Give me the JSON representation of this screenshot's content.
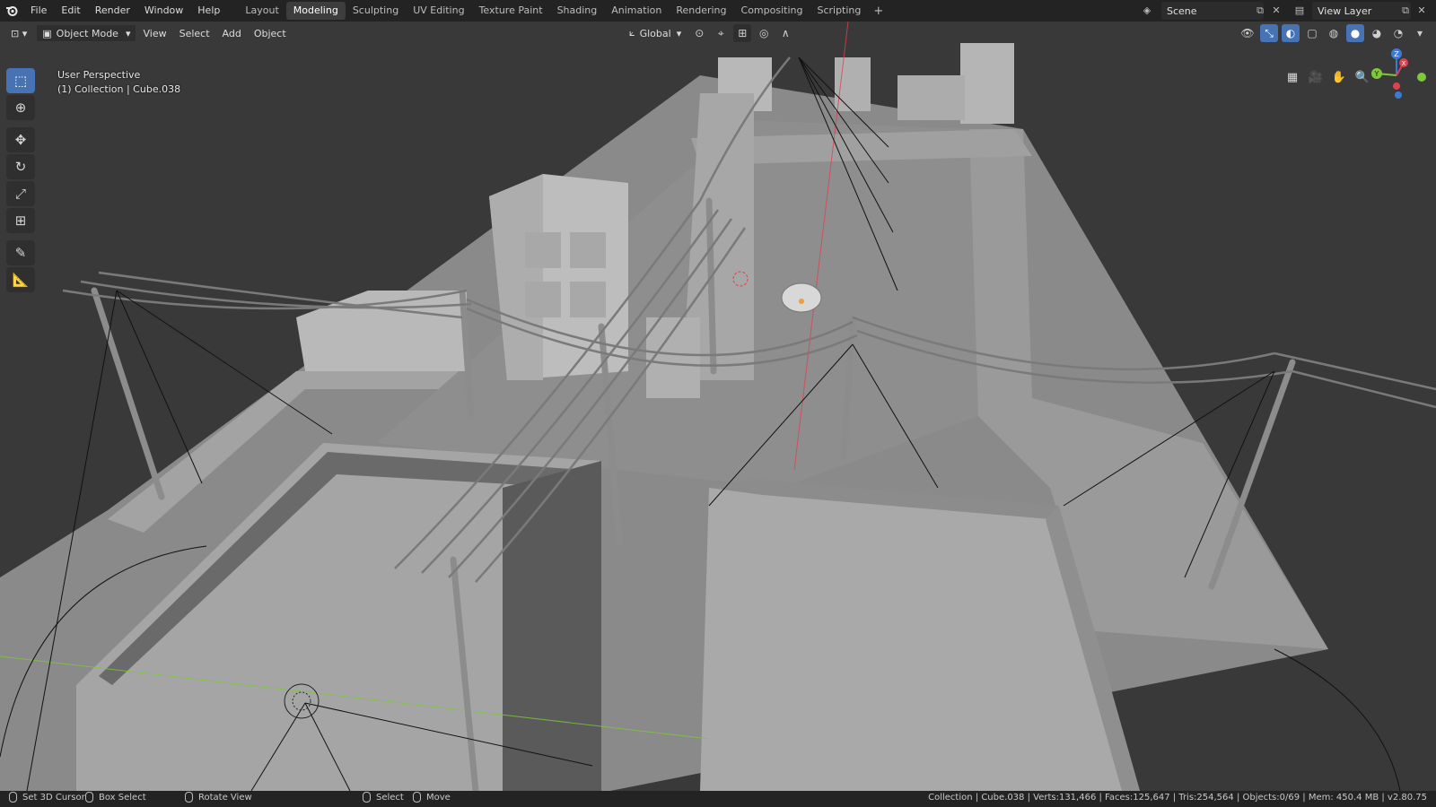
{
  "menu": [
    "File",
    "Edit",
    "Render",
    "Window",
    "Help"
  ],
  "workspace_tabs": [
    {
      "label": "Layout",
      "active": false
    },
    {
      "label": "Modeling",
      "active": true
    },
    {
      "label": "Sculpting",
      "active": false
    },
    {
      "label": "UV Editing",
      "active": false
    },
    {
      "label": "Texture Paint",
      "active": false
    },
    {
      "label": "Shading",
      "active": false
    },
    {
      "label": "Animation",
      "active": false
    },
    {
      "label": "Rendering",
      "active": false
    },
    {
      "label": "Compositing",
      "active": false
    },
    {
      "label": "Scripting",
      "active": false
    }
  ],
  "workspace_add": "+",
  "scene": {
    "label": "Scene"
  },
  "view_layer": {
    "label": "View Layer"
  },
  "viewport_header": {
    "mode": "Object Mode",
    "menus": [
      "View",
      "Select",
      "Add",
      "Object"
    ],
    "transform_orientation": "Global"
  },
  "viewport_info": {
    "perspective": "User Perspective",
    "collection": "(1) Collection | Cube.038"
  },
  "gizmo": {
    "x": "X",
    "y": "Y",
    "z": "Z"
  },
  "status_bar": {
    "left": [
      "Set 3D Cursor",
      "Box Select",
      "Rotate View",
      "Select",
      "Move"
    ],
    "right": "Collection | Cube.038 | Verts:131,466 | Faces:125,647 | Tris:254,564 | Objects:0/69 | Mem: 450.4 MB | v2.80.75"
  },
  "colors": {
    "accent": "#4772b3",
    "viewport_bg": "#393939",
    "axis_x": "#e04050",
    "axis_y": "#7ec83a",
    "axis_z": "#3d7ad6"
  }
}
